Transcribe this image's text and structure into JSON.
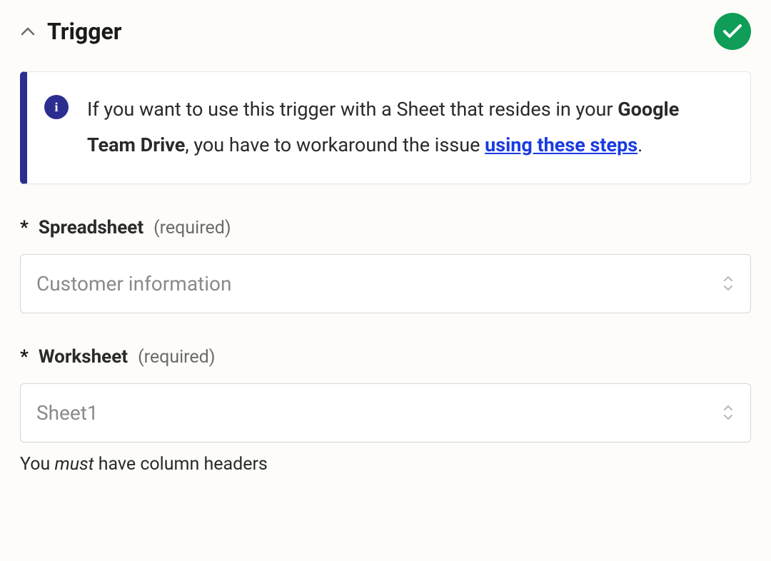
{
  "section": {
    "title": "Trigger"
  },
  "info": {
    "prefix": "If you want to use this trigger with a Sheet that resides in your ",
    "bold": "Google Team Drive",
    "mid": ", you have to workaround the issue ",
    "link": "using these steps",
    "suffix": "."
  },
  "fields": {
    "spreadsheet": {
      "label": "Spreadsheet",
      "required": "(required)",
      "value": "Customer information"
    },
    "worksheet": {
      "label": "Worksheet",
      "required": "(required)",
      "value": "Sheet1",
      "helper_pre": "You ",
      "helper_italic": "must",
      "helper_post": " have column headers"
    }
  }
}
